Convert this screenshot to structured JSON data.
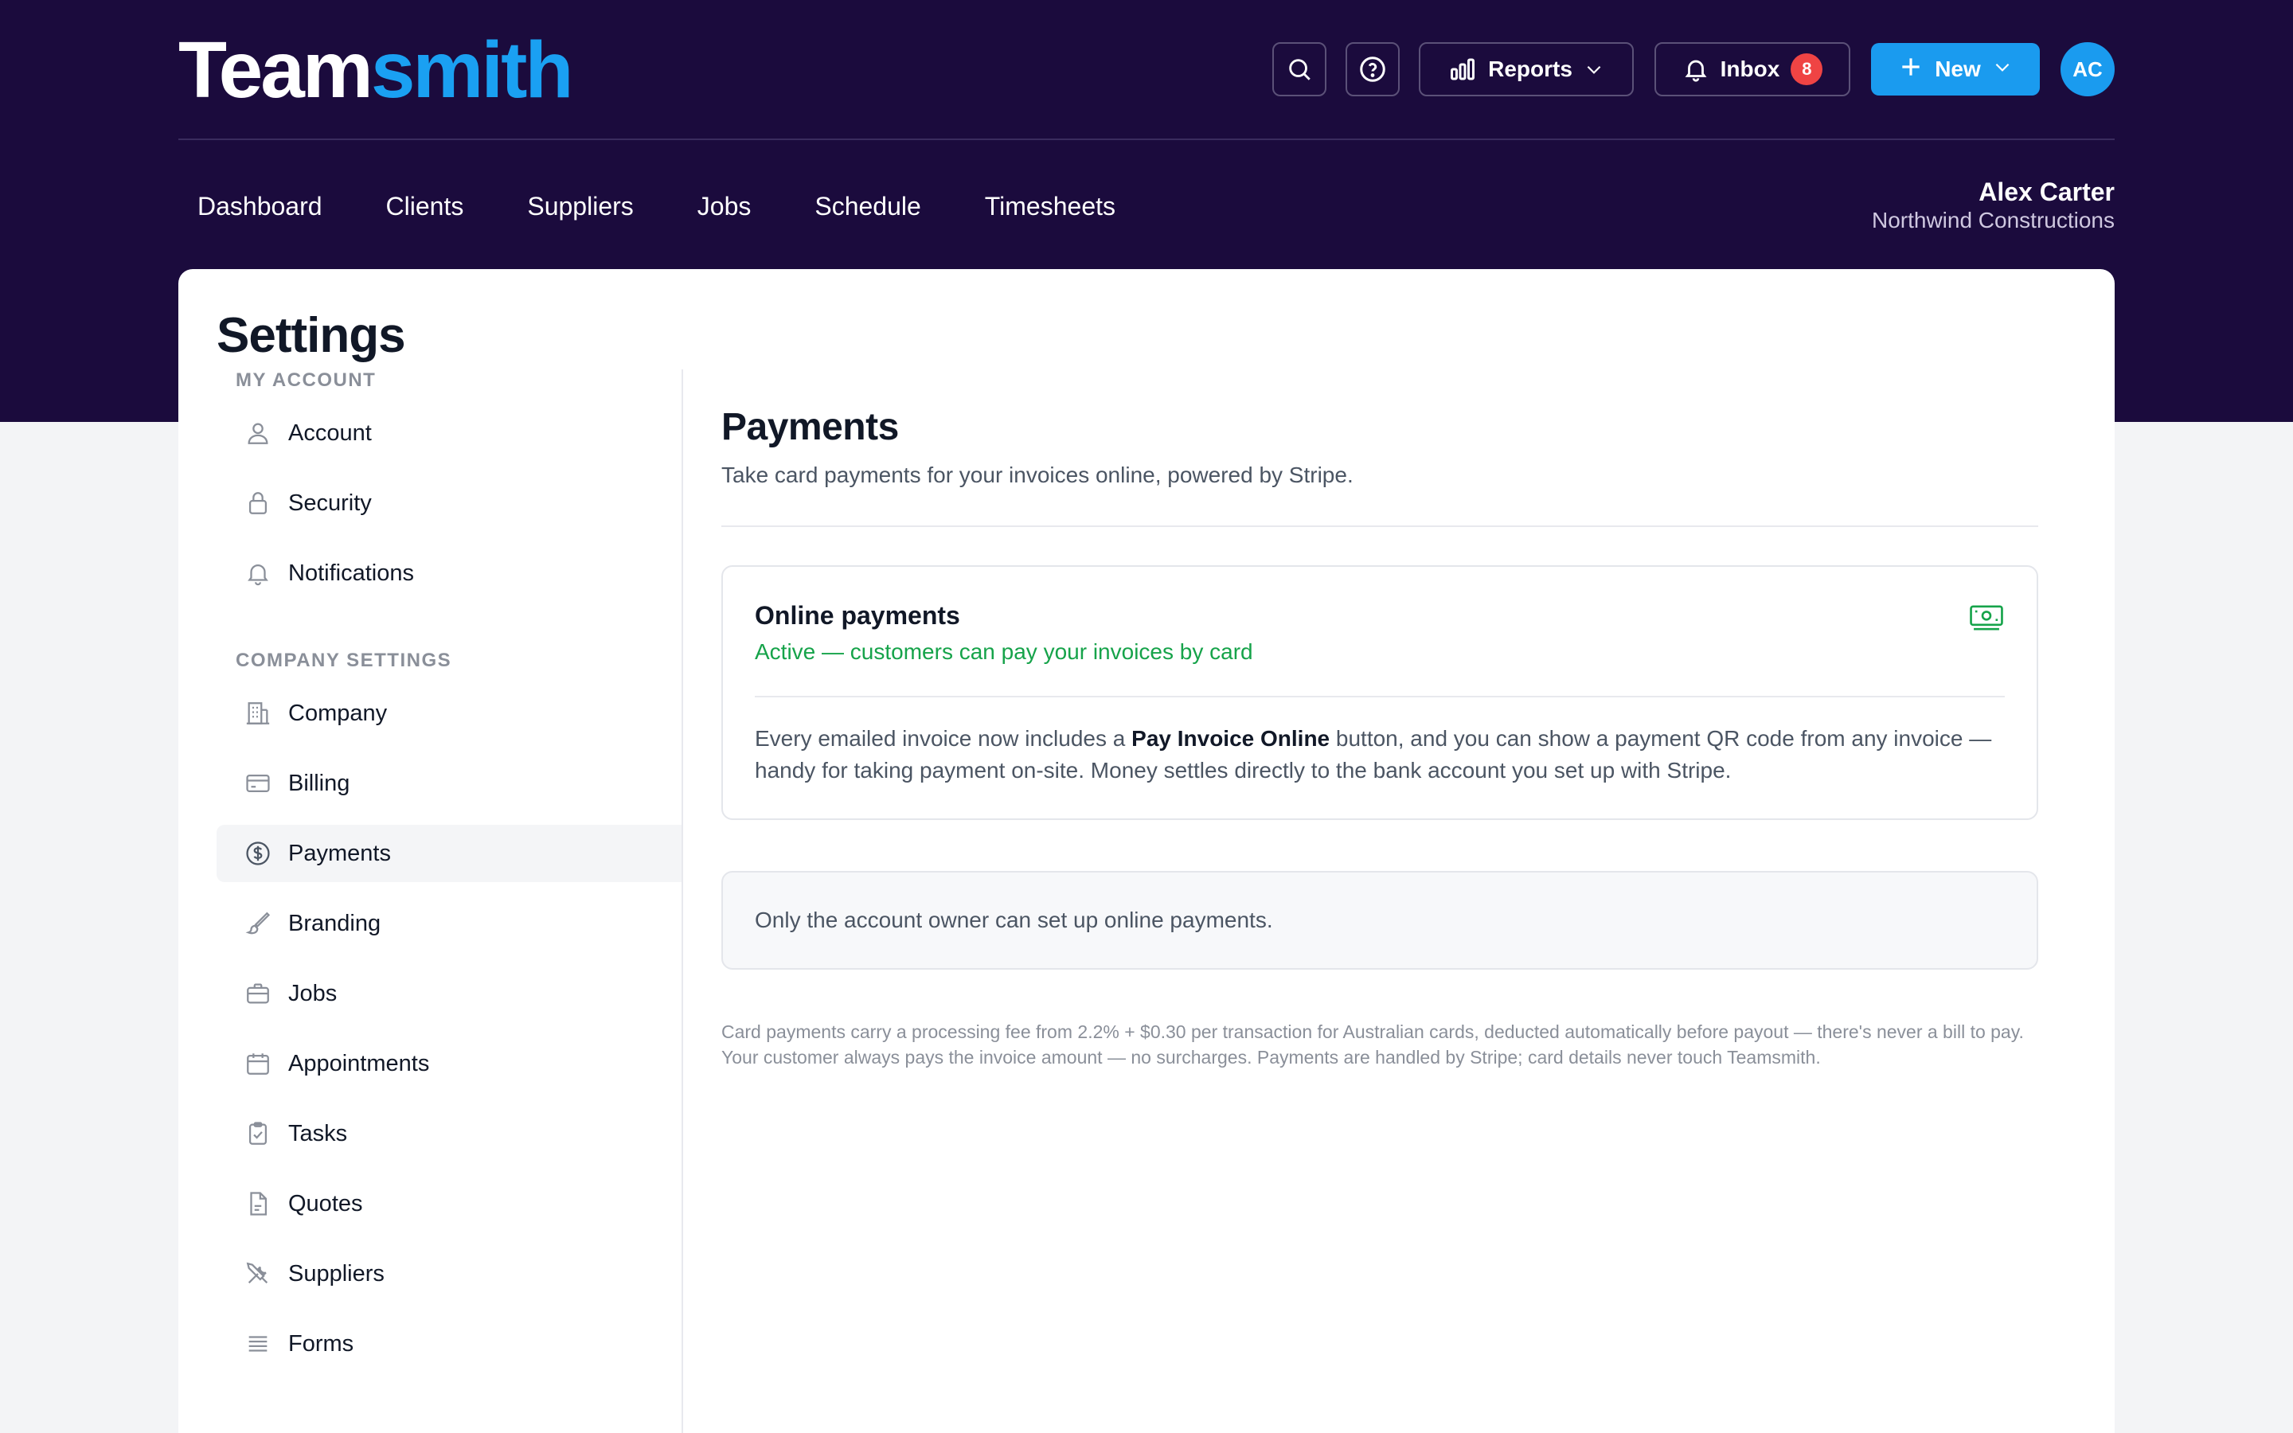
{
  "app": {
    "logo_part1": "Team",
    "logo_part2": "smith"
  },
  "header": {
    "search_icon": "search-icon",
    "help_icon": "help-circle-icon",
    "reports_label": "Reports",
    "inbox_label": "Inbox",
    "inbox_count": "8",
    "new_label": "New",
    "avatar_initials": "AC"
  },
  "nav": {
    "items": [
      "Dashboard",
      "Clients",
      "Suppliers",
      "Jobs",
      "Schedule",
      "Timesheets"
    ]
  },
  "user": {
    "name": "Alex Carter",
    "company": "Northwind Constructions"
  },
  "page": {
    "title": "Settings"
  },
  "sidebar": {
    "my_account_heading": "MY ACCOUNT",
    "company_settings_heading": "COMPANY SETTINGS",
    "account_items": [
      {
        "label": "Account",
        "icon": "user-icon"
      },
      {
        "label": "Security",
        "icon": "lock-icon"
      },
      {
        "label": "Notifications",
        "icon": "bell-icon"
      }
    ],
    "company_items": [
      {
        "label": "Company",
        "icon": "building-icon"
      },
      {
        "label": "Billing",
        "icon": "credit-card-icon"
      },
      {
        "label": "Payments",
        "icon": "dollar-circle-icon"
      },
      {
        "label": "Branding",
        "icon": "paintbrush-icon"
      },
      {
        "label": "Jobs",
        "icon": "briefcase-icon"
      },
      {
        "label": "Appointments",
        "icon": "calendar-icon"
      },
      {
        "label": "Tasks",
        "icon": "clipboard-check-icon"
      },
      {
        "label": "Quotes",
        "icon": "document-icon"
      },
      {
        "label": "Suppliers",
        "icon": "tools-icon"
      },
      {
        "label": "Forms",
        "icon": "list-icon"
      }
    ]
  },
  "payments": {
    "title": "Payments",
    "subtitle": "Take card payments for your invoices online, powered by Stripe.",
    "card_title": "Online payments",
    "card_status": "Active — customers can pay your invoices by card",
    "card_icon": "banknote-icon",
    "body_before": "Every emailed invoice now includes a ",
    "body_bold": "Pay Invoice Online",
    "body_after": " button, and you can show a payment QR code from any invoice — handy for taking payment on-site. Money settles directly to the bank account you set up with Stripe.",
    "notice": "Only the account owner can set up online payments.",
    "fineprint": "Card payments carry a processing fee from 2.2% + $0.30 per transaction for Australian cards, deducted automatically before payout — there's never a bill to pay. Your customer always pays the invoice amount — no surcharges. Payments are handled by Stripe; card details never touch Teamsmith."
  },
  "colors": {
    "topband": "#1b0b3d",
    "accent": "#1a9bef",
    "success": "#16a34a",
    "badge": "#ef4444"
  }
}
